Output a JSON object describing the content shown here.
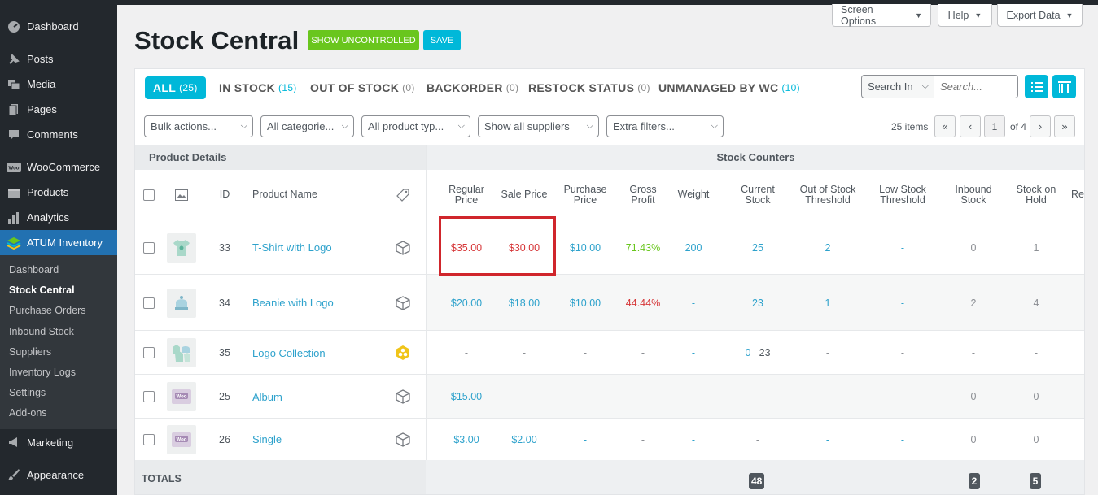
{
  "sidebar": {
    "top_items": [
      {
        "label": "Dashboard",
        "icon": "dashboard-icon"
      },
      {
        "label": "Posts",
        "icon": "pin-icon"
      },
      {
        "label": "Media",
        "icon": "media-icon"
      },
      {
        "label": "Pages",
        "icon": "pages-icon"
      },
      {
        "label": "Comments",
        "icon": "comments-icon"
      }
    ],
    "woo_items": [
      {
        "label": "WooCommerce",
        "icon": "woocommerce-icon"
      },
      {
        "label": "Products",
        "icon": "products-icon"
      },
      {
        "label": "Analytics",
        "icon": "analytics-icon"
      },
      {
        "label": "ATUM Inventory",
        "icon": "atum-icon"
      }
    ],
    "submenu": [
      "Dashboard",
      "Stock Central",
      "Purchase Orders",
      "Inbound Stock",
      "Suppliers",
      "Inventory Logs",
      "Settings",
      "Add-ons"
    ],
    "bottom_items": [
      {
        "label": "Marketing",
        "icon": "megaphone-icon"
      },
      {
        "label": "Appearance",
        "icon": "brush-icon"
      }
    ]
  },
  "topbar": {
    "screen_options": "Screen Options",
    "help": "Help",
    "export_data": "Export Data"
  },
  "header": {
    "title": "Stock Central",
    "show_uncontrolled": "SHOW UNCONTROLLED",
    "save": "SAVE"
  },
  "tabs": [
    {
      "label": "ALL",
      "count": "(25)"
    },
    {
      "label": "IN STOCK",
      "count": "(15)"
    },
    {
      "label": "OUT OF STOCK",
      "count": "(0)"
    },
    {
      "label": "BACKORDER",
      "count": "(0)"
    },
    {
      "label": "RESTOCK STATUS",
      "count": "(0)"
    },
    {
      "label": "UNMANAGED BY WC",
      "count": "(10)"
    }
  ],
  "search": {
    "in_label": "Search In",
    "placeholder": "Search..."
  },
  "filters": [
    "Bulk actions...",
    "All categorie...",
    "All product typ...",
    "Show all suppliers",
    "Extra filters..."
  ],
  "pagination": {
    "items": "25 items",
    "first": "«",
    "prev": "‹",
    "current": "1",
    "of": "of 4",
    "next": "›",
    "last": "»"
  },
  "table": {
    "group_left": "Product Details",
    "group_right": "Stock Counters",
    "headers": {
      "id": "ID",
      "name": "Product Name",
      "regular_price": "Regular Price",
      "sale_price": "Sale Price",
      "purchase_price": "Purchase Price",
      "gross_profit": "Gross Profit",
      "weight": "Weight",
      "current_stock": "Current Stock",
      "out_of_stock_threshold": "Out of Stock Threshold",
      "low_stock_threshold": "Low Stock Threshold",
      "inbound_stock": "Inbound Stock",
      "stock_on_hold": "Stock on Hold",
      "truncated": "Re"
    },
    "rows": [
      {
        "id": "33",
        "name": "T-Shirt with Logo",
        "type_icon": "simple-product-icon",
        "regular_price": "$35.00",
        "sale_price": "$30.00",
        "purchase_price": "$10.00",
        "gross_profit": "71.43%",
        "weight": "200",
        "current_stock": "25",
        "oos_threshold": "2",
        "low_threshold": "-",
        "inbound": "0",
        "on_hold": "1"
      },
      {
        "id": "34",
        "name": "Beanie with Logo",
        "type_icon": "simple-product-icon",
        "regular_price": "$20.00",
        "sale_price": "$18.00",
        "purchase_price": "$10.00",
        "gross_profit": "44.44%",
        "weight": "-",
        "current_stock": "23",
        "oos_threshold": "1",
        "low_threshold": "-",
        "inbound": "2",
        "on_hold": "4"
      },
      {
        "id": "35",
        "name": "Logo Collection",
        "type_icon": "grouped-product-icon",
        "regular_price": "-",
        "sale_price": "-",
        "purchase_price": "-",
        "gross_profit": "-",
        "weight": "-",
        "current_stock_a": "0",
        "current_stock_sep": " | ",
        "current_stock_b": "23",
        "oos_threshold": "-",
        "low_threshold": "-",
        "inbound": "-",
        "on_hold": "-"
      },
      {
        "id": "25",
        "name": "Album",
        "type_icon": "simple-product-icon",
        "regular_price": "$15.00",
        "sale_price": "-",
        "purchase_price": "-",
        "gross_profit": "-",
        "weight": "-",
        "current_stock": "-",
        "oos_threshold": "-",
        "low_threshold": "-",
        "inbound": "0",
        "on_hold": "0"
      },
      {
        "id": "26",
        "name": "Single",
        "type_icon": "simple-product-icon",
        "regular_price": "$3.00",
        "sale_price": "$2.00",
        "purchase_price": "-",
        "gross_profit": "-",
        "weight": "-",
        "current_stock": "-",
        "oos_threshold": "-",
        "low_threshold": "-",
        "inbound": "0",
        "on_hold": "0"
      }
    ],
    "totals": {
      "label": "TOTALS",
      "current_stock": "48",
      "inbound": "2",
      "on_hold": "5"
    }
  },
  "colors": {
    "accent": "#00b8d9",
    "green": "#69c61d",
    "red": "#d63638",
    "link": "#2ea2cc",
    "highlight": "#d0262c"
  }
}
